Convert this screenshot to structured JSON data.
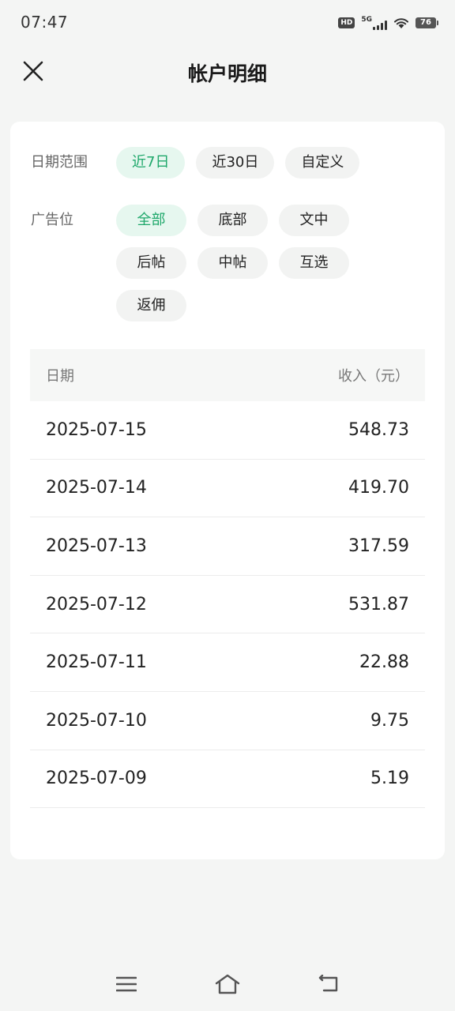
{
  "status_bar": {
    "time": "07:47",
    "hd": "HD",
    "network": "5G",
    "battery": "76"
  },
  "header": {
    "title": "帐户明细"
  },
  "filters": {
    "date_label": "日期范围",
    "date_options": [
      "近7日",
      "近30日",
      "自定义"
    ],
    "date_selected": "近7日",
    "ad_label": "广告位",
    "ad_options": [
      "全部",
      "底部",
      "文中",
      "后帖",
      "中帖",
      "互选",
      "返佣"
    ],
    "ad_selected": "全部"
  },
  "table": {
    "col_date": "日期",
    "col_income": "收入（元）",
    "rows": [
      {
        "date": "2025-07-15",
        "income": "548.73"
      },
      {
        "date": "2025-07-14",
        "income": "419.70"
      },
      {
        "date": "2025-07-13",
        "income": "317.59"
      },
      {
        "date": "2025-07-12",
        "income": "531.87"
      },
      {
        "date": "2025-07-11",
        "income": "22.88"
      },
      {
        "date": "2025-07-10",
        "income": "9.75"
      },
      {
        "date": "2025-07-09",
        "income": "5.19"
      }
    ]
  },
  "colors": {
    "accent": "#1fa86b",
    "accent_bg": "#e6f7ef",
    "chip_bg": "#f2f3f2",
    "page_bg": "#f4f5f4"
  },
  "icons": {
    "close": "close-icon",
    "menu": "menu-icon",
    "home": "home-icon",
    "back": "back-icon"
  }
}
